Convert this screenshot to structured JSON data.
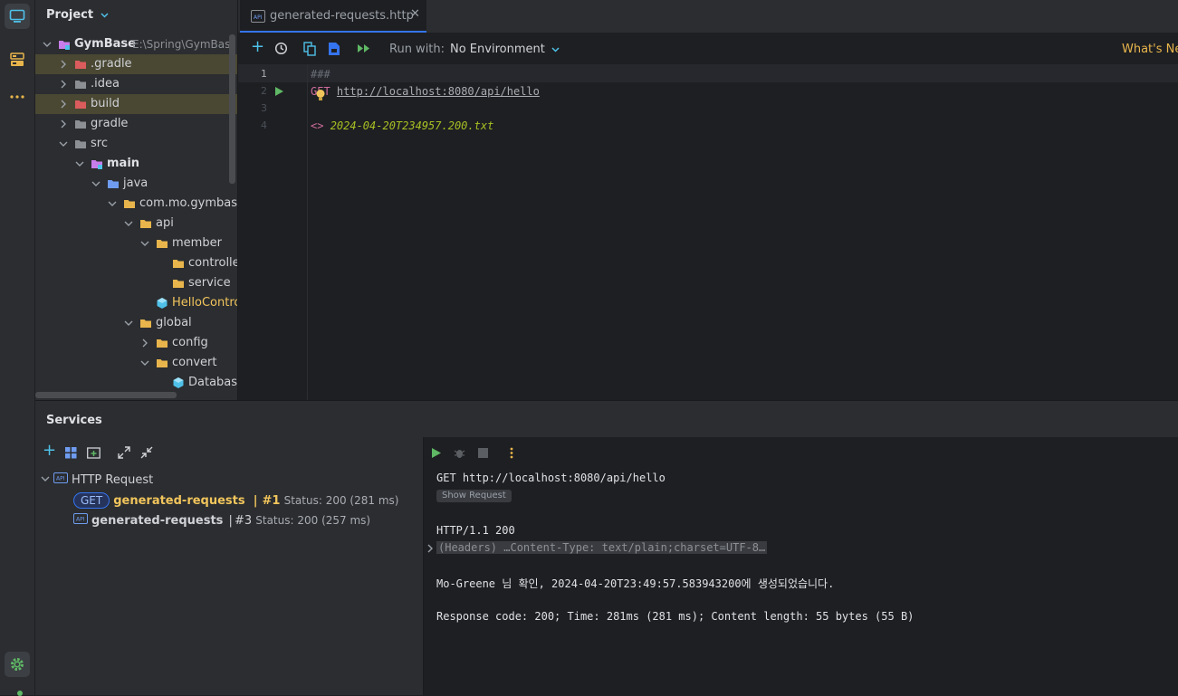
{
  "sidebar_icons": [
    "project-icon",
    "structure-icon",
    "more-icon",
    "settings-icon"
  ],
  "project": {
    "title": "Project",
    "tree": [
      {
        "label": "GymBase",
        "hint": "E:\\Spring\\GymBas",
        "icon": "module-folder",
        "depth": 0,
        "expanded": true,
        "bold": true
      },
      {
        "label": ".gradle",
        "icon": "folder-red",
        "depth": 1,
        "expanded": false,
        "highlight": true
      },
      {
        "label": ".idea",
        "icon": "folder-gray",
        "depth": 1,
        "expanded": false
      },
      {
        "label": "build",
        "icon": "folder-red",
        "depth": 1,
        "expanded": false,
        "highlight": true
      },
      {
        "label": "gradle",
        "icon": "folder-gray",
        "depth": 1,
        "expanded": false
      },
      {
        "label": "src",
        "icon": "folder-gray",
        "depth": 1,
        "expanded": true
      },
      {
        "label": "main",
        "icon": "module-folder",
        "depth": 2,
        "expanded": true,
        "bold": true
      },
      {
        "label": "java",
        "icon": "folder-blue",
        "depth": 3,
        "expanded": true
      },
      {
        "label": "com.mo.gymbase",
        "icon": "folder-yellow",
        "depth": 4,
        "expanded": true
      },
      {
        "label": "api",
        "icon": "folder-yellow",
        "depth": 5,
        "expanded": true
      },
      {
        "label": "member",
        "icon": "folder-yellow",
        "depth": 6,
        "expanded": true
      },
      {
        "label": "controller",
        "icon": "folder-yellow",
        "depth": 7,
        "leaf": true
      },
      {
        "label": "service",
        "icon": "folder-yellow",
        "depth": 7,
        "leaf": true
      },
      {
        "label": "HelloContro",
        "icon": "class",
        "depth": 6,
        "leaf": true,
        "yellow": true
      },
      {
        "label": "global",
        "icon": "folder-yellow",
        "depth": 5,
        "expanded": true
      },
      {
        "label": "config",
        "icon": "folder-yellow",
        "depth": 6,
        "expanded": false
      },
      {
        "label": "convert",
        "icon": "folder-yellow",
        "depth": 6,
        "expanded": true
      },
      {
        "label": "Database",
        "icon": "class",
        "depth": 7,
        "leaf": true
      }
    ]
  },
  "editor": {
    "tab_label": "generated-requests.http",
    "toolbar": {
      "run_with_label": "Run with:",
      "environment": "No Environment",
      "whats_new": "What's Ne"
    },
    "lines": [
      {
        "num": "1",
        "text": "###"
      },
      {
        "num": "2",
        "method": "GET",
        "url": "http://localhost:8080/api/hello"
      },
      {
        "num": "3",
        "text": ""
      },
      {
        "num": "4",
        "prefix": "<>",
        "file": "2024-04-20T234957.200.txt"
      }
    ]
  },
  "services": {
    "title": "Services",
    "root_label": "HTTP Request",
    "items": [
      {
        "badge": "GET",
        "name": "generated-requests",
        "sep": "|",
        "run": "#1",
        "status": "Status: 200 (281 ms)"
      },
      {
        "name": "generated-requests",
        "sep": "|",
        "run": "#3",
        "status": "Status: 200 (257 ms)"
      }
    ],
    "response": {
      "request_line": "GET http://localhost:8080/api/hello",
      "show_request": "Show Request",
      "status_line": "HTTP/1.1 200",
      "headers": "(Headers) …Content-Type: text/plain;charset=UTF-8…",
      "body": "Mo-Greene 님 확인, 2024-04-20T23:49:57.583943200에 생성되었습니다.",
      "summary": "Response code: 200; Time: 281ms (281 ms); Content length: 55 bytes (55 B)"
    }
  },
  "colors": {
    "accent": "#3574f0",
    "run_green": "#5fb865",
    "folder_yellow": "#e8b54c",
    "folder_red": "#db5c5c",
    "folder_blue": "#6f9cf0",
    "module_purple": "#c77dea",
    "keyword_pink": "#cf6d9e"
  }
}
